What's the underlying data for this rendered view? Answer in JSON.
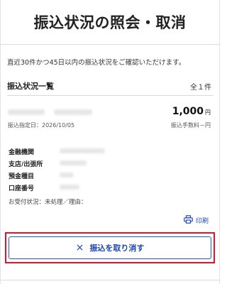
{
  "header": {
    "title": "振込状況の照会・取消"
  },
  "notice": "直近30件かつ45日以内の振込状況をご確認いただけます。",
  "list": {
    "title": "振込状況一覧",
    "count": "全１件"
  },
  "transfer": {
    "amount": "1,000",
    "amount_unit": "円",
    "date": "振込指定日：2026/10/05",
    "fee": "振込手数料－円",
    "labels": {
      "bank": "金融機関",
      "branch": "支店/出張所",
      "account_type": "預金種目",
      "account_number": "口座番号"
    },
    "status": "お受付状況：未処理／理由："
  },
  "actions": {
    "print_label": "印刷",
    "cancel_label": "振込を取り消す",
    "cancel_icon": "×"
  },
  "colors": {
    "link_blue": "#1f4bb8",
    "highlight_red": "#e0152d"
  }
}
